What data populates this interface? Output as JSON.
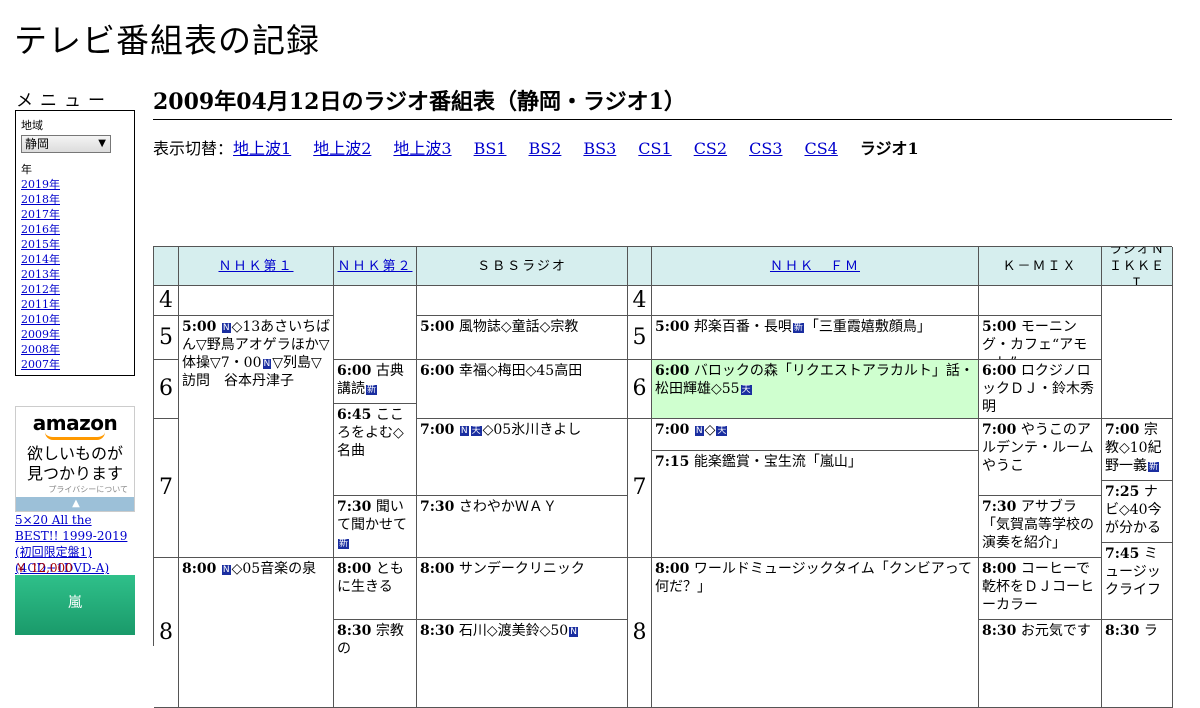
{
  "site_title": "テレビ番組表の記録",
  "menu": {
    "label": "メニュー",
    "region_label": "地域",
    "region_value": "静岡",
    "year_label": "年",
    "years": [
      "2019年",
      "2018年",
      "2017年",
      "2016年",
      "2015年",
      "2014年",
      "2013年",
      "2012年",
      "2011年",
      "2010年",
      "2009年",
      "2008年",
      "2007年"
    ]
  },
  "ad": {
    "logo": "amazon",
    "copy_line1": "欲しいものが",
    "copy_line2": "見つかります",
    "privacy": "プライバシーについて",
    "arrow": "▲"
  },
  "product": {
    "title": "5×20 All the BEST!! 1999-2019 (初回限定盤1) (4CD+1DVD-A)",
    "price": "￥ 12,000",
    "banner": "嵐"
  },
  "heading": "2009年04月12日のラジオ番組表（静岡・ラジオ1）",
  "switcher": {
    "label": "表示切替：",
    "links": [
      "地上波1",
      "地上波2",
      "地上波3",
      "BS1",
      "BS2",
      "BS3",
      "CS1",
      "CS2",
      "CS3",
      "CS4"
    ],
    "current": "ラジオ1"
  },
  "badges": {
    "news": "N",
    "weather": "天",
    "new": "新"
  },
  "schedule": {
    "stations": [
      {
        "name": "ＮＨＫ第１",
        "link": true
      },
      {
        "name": "ＮＨＫ第２",
        "link": true
      },
      {
        "name": "ＳＢＳラジオ",
        "link": false
      },
      {
        "name": "ＮＨＫ　ＦＭ",
        "link": true
      },
      {
        "name": "Ｋ－ＭＩＸ",
        "link": false
      },
      {
        "name": "ラジオＮＩＫＫＥＩ",
        "link": false
      }
    ],
    "hours": [
      "4",
      "5",
      "6",
      "7",
      "8"
    ],
    "programs": {
      "p1": {
        "time": "5:00",
        "pre": "",
        "text": "◇13あさいちばん▽野鳥アオゲラほか▽体操▽7・00",
        "text2": "▽列島▽訪問　谷本丹津子"
      },
      "p2": {
        "time": "8:00",
        "text": "◇05音楽の泉"
      },
      "p3": {
        "time": "6:00",
        "text": "古典講読"
      },
      "p4": {
        "time": "6:45",
        "text": "こころをよむ◇名曲"
      },
      "p5": {
        "time": "7:30",
        "text": "聞いて聞かせて"
      },
      "p6": {
        "time": "8:00",
        "text": "ともに生きる"
      },
      "p7": {
        "time": "8:30",
        "text": "宗教の"
      },
      "p8": {
        "time": "5:00",
        "text": "風物誌◇童話◇宗教"
      },
      "p9": {
        "time": "6:00",
        "text": "幸福◇梅田◇45高田"
      },
      "p10": {
        "time": "7:00",
        "text": "◇05氷川きよし"
      },
      "p11": {
        "time": "7:30",
        "text": "さわやかＷＡＹ"
      },
      "p12": {
        "time": "8:00",
        "text": "サンデークリニック"
      },
      "p13": {
        "time": "8:30",
        "text": "石川◇渡美鈴◇50"
      },
      "p14": {
        "time": "5:00",
        "text": "邦楽百番・長唄",
        "text2": "「三重霞嬉敷顔鳥」"
      },
      "p15": {
        "time": "6:00",
        "text": "バロックの森「リクエストアラカルト」話・松田輝雄◇55"
      },
      "p16": {
        "time": "7:00",
        "text": "◇"
      },
      "p17": {
        "time": "7:15",
        "text": "能楽鑑賞・宝生流「嵐山」"
      },
      "p18": {
        "time": "8:00",
        "text": "ワールドミュージックタイム「クンビアって何だ？」"
      },
      "p19": {
        "time": "5:00",
        "text": "モーニング・カフェ“アモーレ”"
      },
      "p20": {
        "time": "6:00",
        "text": "ロクジノロックＤＪ・鈴木秀明"
      },
      "p21": {
        "time": "7:00",
        "text": "やうこのアルデンテ・ルームやうこ"
      },
      "p22": {
        "time": "7:30",
        "text": "アサブラ「気賀高等学校の演奏を紹介」"
      },
      "p23": {
        "time": "8:00",
        "text": "コーヒーで乾杯をＤＪコーヒーカラー"
      },
      "p24": {
        "time": "8:30",
        "text": "お元気です"
      },
      "p25": {
        "time": "7:00",
        "text": "宗教◇10紀野一義"
      },
      "p26": {
        "time": "7:25",
        "text": "ナビ◇40今が分かる"
      },
      "p27": {
        "time": "7:45",
        "text": "ミュージックライフ"
      },
      "p28": {
        "time": "8:30",
        "text": "ラ"
      }
    }
  }
}
